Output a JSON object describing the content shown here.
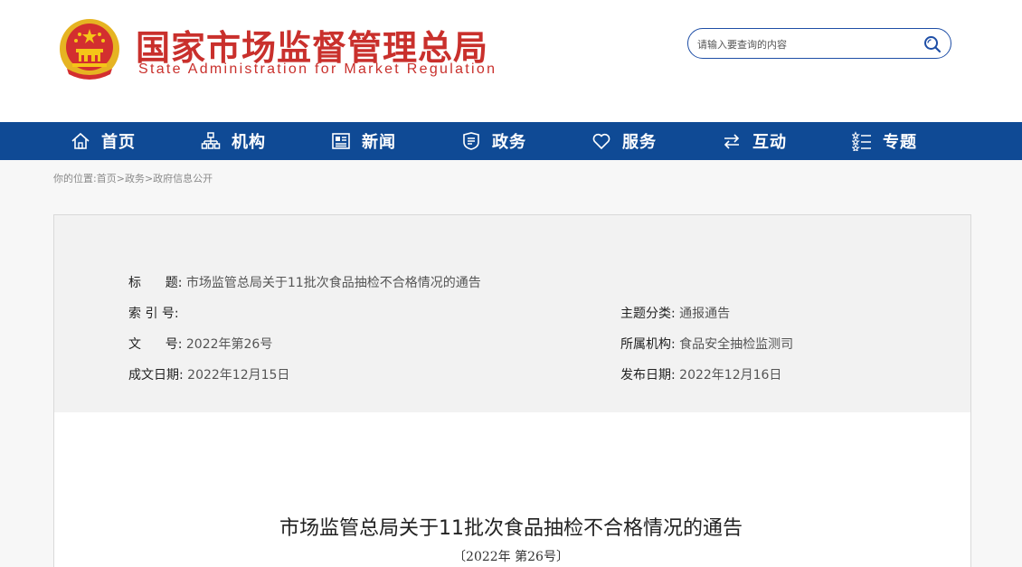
{
  "header": {
    "title_cn": "国家市场监督管理总局",
    "title_en": "State Administration for Market Regulation"
  },
  "search": {
    "placeholder": "请输入要查询的内容"
  },
  "nav": {
    "items": [
      {
        "label": "首页",
        "icon": "home-icon"
      },
      {
        "label": "机构",
        "icon": "org-chart-icon"
      },
      {
        "label": "新闻",
        "icon": "news-icon"
      },
      {
        "label": "政务",
        "icon": "government-icon"
      },
      {
        "label": "服务",
        "icon": "heart-icon"
      },
      {
        "label": "互动",
        "icon": "exchange-arrows-icon"
      },
      {
        "label": "专题",
        "icon": "stars-list-icon"
      }
    ]
  },
  "breadcrumb": {
    "prefix": "你的位置:",
    "items": [
      "首页",
      "政务",
      "政府信息公开"
    ],
    "separator": ">"
  },
  "info": {
    "title_key": "标      题:",
    "title_value": "市场监管总局关于11批次食品抽检不合格情况的通告",
    "index_key": "索 引 号:",
    "index_value": "",
    "topic_key": "主题分类:",
    "topic_value": "通报通告",
    "docno_key": "文      号:",
    "docno_value": "2022年第26号",
    "org_key": "所属机构:",
    "org_value": "食品安全抽检监测司",
    "created_key": "成文日期:",
    "created_value": "2022年12月15日",
    "published_key": "发布日期:",
    "published_value": "2022年12月16日"
  },
  "document": {
    "title": "市场监管总局关于11批次食品抽检不合格情况的通告",
    "number": "〔2022年 第26号〕"
  },
  "colors": {
    "brand_red": "#c9302c",
    "nav_blue": "#0f4a95"
  }
}
